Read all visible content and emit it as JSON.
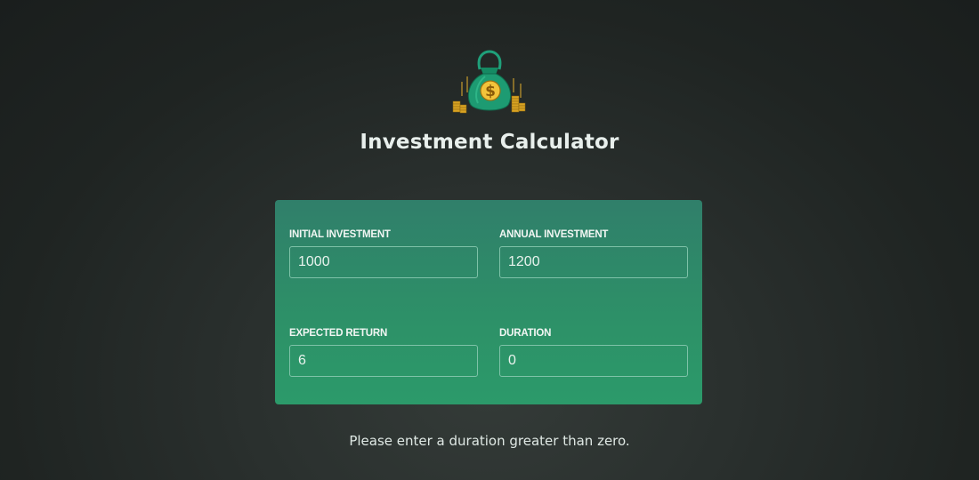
{
  "header": {
    "logo_icon": "money-bag-icon",
    "title": "Investment Calculator"
  },
  "form": {
    "initial_investment": {
      "label": "Initial Investment",
      "value": "1000"
    },
    "annual_investment": {
      "label": "Annual Investment",
      "value": "1200"
    },
    "expected_return": {
      "label": "Expected Return",
      "value": "6"
    },
    "duration": {
      "label": "Duration",
      "value": "0"
    }
  },
  "message": "Please enter a duration greater than zero.",
  "colors": {
    "panel_top": "#307f6a",
    "panel_bottom": "#2c9a6a",
    "background": "#232826",
    "bag_green": "#1f9e73",
    "coin_gold": "#e6b12e"
  }
}
